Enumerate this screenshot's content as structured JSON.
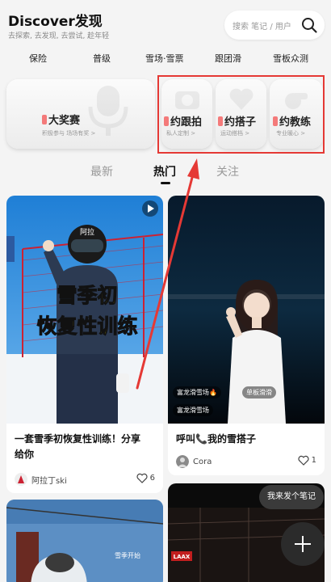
{
  "header": {
    "title": "Discover发现",
    "subtitle": "去探索, 去发现, 去尝试, 趁年轻",
    "search_placeholder": "搜索 笔记 / 用户"
  },
  "categories": [
    "保险",
    "普级",
    "雪场·雪票",
    "跟团滑",
    "雪板众测"
  ],
  "promos": {
    "big": {
      "title": "大奖赛",
      "subtitle": "积极参与 场场有奖 >"
    },
    "small": [
      {
        "title": "约跟拍",
        "subtitle": "私人定制 >"
      },
      {
        "title": "约搭子",
        "subtitle": "运动搭档 >"
      },
      {
        "title": "约教练",
        "subtitle": "专业暖心 >"
      }
    ]
  },
  "tabs": [
    {
      "label": "最新",
      "active": false
    },
    {
      "label": "热门",
      "active": true
    },
    {
      "label": "关注",
      "active": false
    }
  ],
  "posts": [
    {
      "overlay_text_1": "雪季初",
      "overlay_text_2": "恢复性训练",
      "helmet_text": "阿拉",
      "title_line1": "一套雪季初恢复性训练！分享",
      "title_line2": "给你",
      "author": "阿拉丁ski",
      "likes": "6"
    },
    {
      "tag1": "富龙滑雪场🔥",
      "tag2": "单板滑滑",
      "tag3": "富龙滑雪场",
      "title": "呼叫📞我的雪搭子",
      "author": "Cora",
      "likes": "1"
    },
    {
      "overlay_text": "雪季开始"
    },
    {
      "badge": "LAAX"
    }
  ],
  "fab": {
    "bubble_text": "我来发个笔记"
  },
  "colors": {
    "accent_red": "#e53935",
    "highlight_pink": "#f47a7a"
  }
}
